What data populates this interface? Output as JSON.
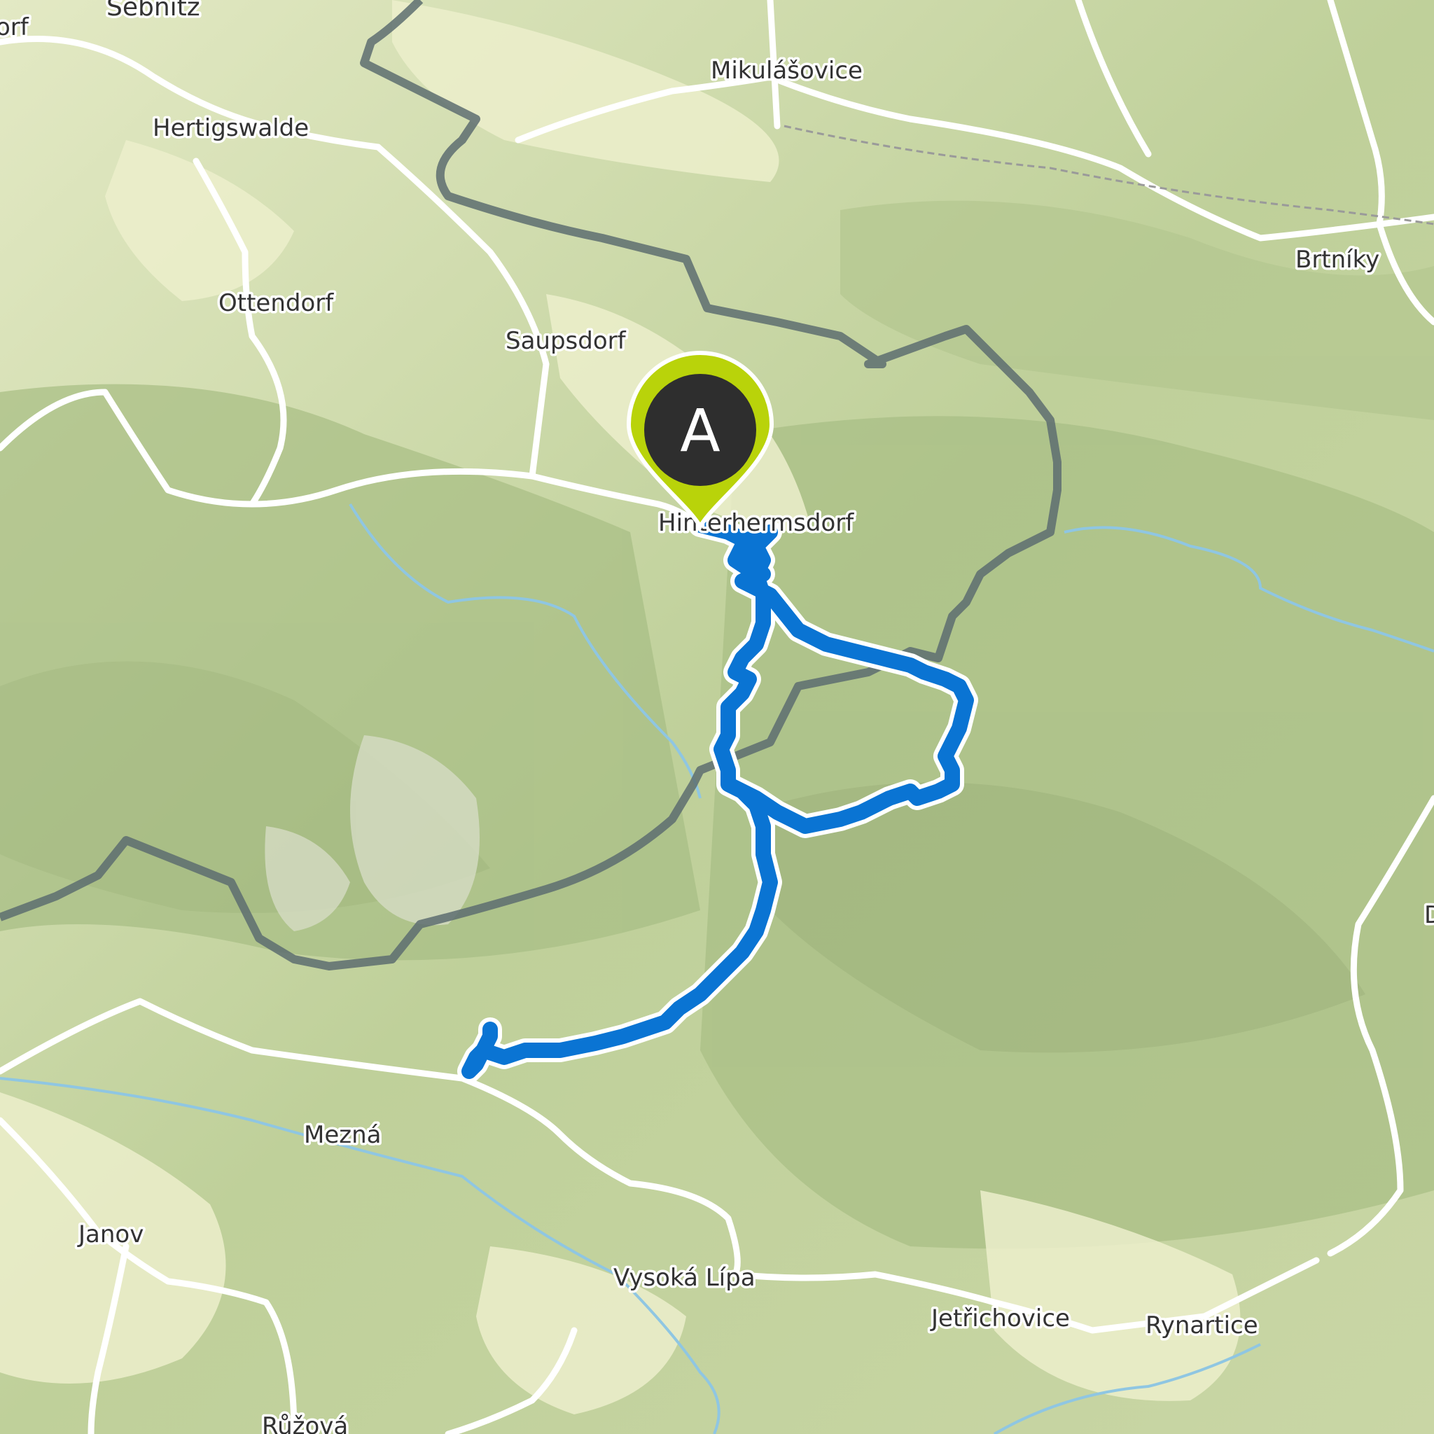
{
  "map": {
    "colors": {
      "route": "#0a74d3",
      "route_outline": "#ffffff",
      "border": "#5d6d70",
      "road": "#ffffff",
      "river": "#8fc6e2",
      "marker_fill": "#b9d30a",
      "marker_inner": "#2e2e2e"
    },
    "marker": {
      "label": "A"
    },
    "places": [
      {
        "key": "sebnitz",
        "name": "Sebnitz"
      },
      {
        "key": "orf",
        "name": "orf"
      },
      {
        "key": "mikulasovice",
        "name": "Mikulášovice"
      },
      {
        "key": "hertigswalde",
        "name": "Hertigswalde"
      },
      {
        "key": "brtniky",
        "name": "Brtníky"
      },
      {
        "key": "ottendorf",
        "name": "Ottendorf"
      },
      {
        "key": "saupsdorf",
        "name": "Saupsdorf"
      },
      {
        "key": "hinterhermsdorf",
        "name": "Hinterhermsdorf"
      },
      {
        "key": "mezna",
        "name": "Mezná"
      },
      {
        "key": "janov",
        "name": "Janov"
      },
      {
        "key": "vysoka_lipa",
        "name": "Vysoká Lípa"
      },
      {
        "key": "jetrichovice",
        "name": "Jetřichovice"
      },
      {
        "key": "rynartice",
        "name": "Rynartice"
      },
      {
        "key": "ruzova",
        "name": "Růžová"
      },
      {
        "key": "edge_d",
        "name": "D"
      }
    ]
  }
}
